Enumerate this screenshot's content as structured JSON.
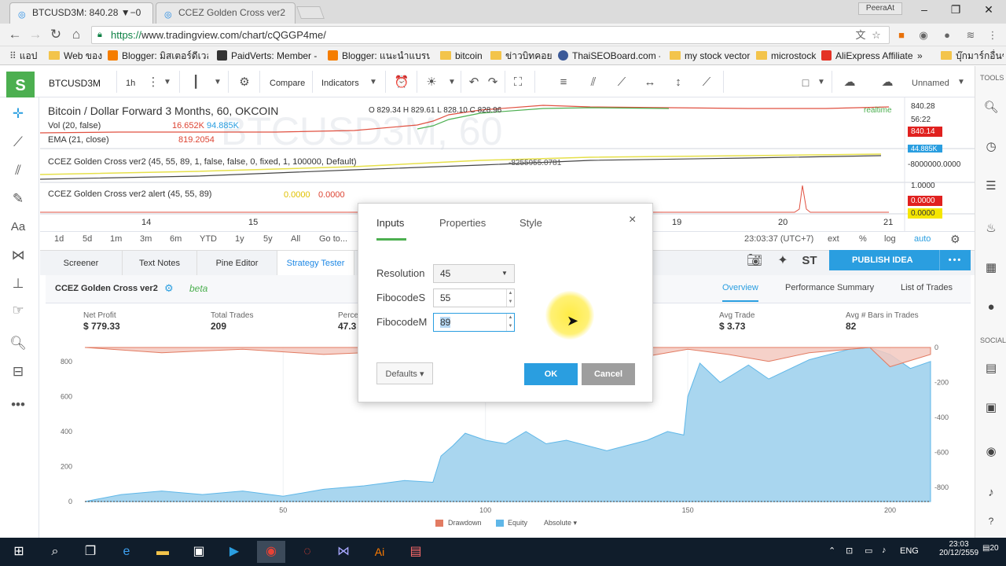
{
  "browser": {
    "tabs": [
      {
        "label": "BTCUSD3M: 840.28 ▼−0",
        "active": true
      },
      {
        "label": "CCEZ Golden Cross ver2",
        "active": false
      }
    ],
    "user": "PeeraAt",
    "url_prefix": "https://",
    "url_rest": "www.tradingview.com/chart/cQGGP4me/",
    "bookmarks": [
      "แอป",
      "Web ของ",
      "Blogger: มิสเตอร์ดีเวลลอปเปอร์",
      "PaidVerts: Member - F",
      "Blogger: แนะนำแบรนด์ดีๆ",
      "bitcoin",
      "ข่าวบิทคอยน์",
      "ThaiSEOBoard.com -",
      "my stock vector",
      "microstock",
      "AliExpress Affiliate",
      "»",
      "บุ๊กมาร์กอื่นๆ"
    ]
  },
  "toolbar": {
    "symbol": "BTCUSD3M",
    "interval": "1h",
    "compare": "Compare",
    "indicators": "Indicators",
    "layout_name": "Unnamed"
  },
  "chart": {
    "main_title": "Bitcoin / Dollar Forward 3 Months, 60, OKCOIN",
    "ohlc": "O 829.34 H 829.61 L 828.10 C 828.96",
    "vol_label": "Vol (20, false)",
    "vol_v1": "16.652K",
    "vol_v2": "94.885K",
    "ema_label": "EMA (21, close)",
    "ema_value": "819.2054",
    "ind1_label": "CCEZ Golden Cross ver2 (45, 55, 89, 1, false, false, 0, fixed, 1, 100000, Default)",
    "ind1_value": "-8255955.0781",
    "ind2_label": "CCEZ Golden Cross ver2 alert (45, 55, 89)",
    "ind2_v1": "0.0000",
    "ind2_v2": "0.0000",
    "realtime": "realtime",
    "watermark": "BTCUSD3M, 60",
    "prices": {
      "p1": "840.28",
      "p2": "56:22",
      "p3": "840.14",
      "p4": "44.885K",
      "p5": "-8000000.0000",
      "p6": "1.0000",
      "p7": "0.0000",
      "p8": "0.0000"
    },
    "time_ticks": [
      "14",
      "15",
      "19",
      "20",
      "21"
    ],
    "ranges": [
      "1d",
      "5d",
      "1m",
      "3m",
      "6m",
      "YTD",
      "1y",
      "5y",
      "All",
      "Go to..."
    ],
    "clock": "23:03:37 (UTC+7)",
    "right_opts": [
      "ext",
      "%",
      "log",
      "auto"
    ]
  },
  "bottom_panel": {
    "tabs": [
      "Screener",
      "Text Notes",
      "Pine Editor",
      "Strategy Tester"
    ],
    "publish": "PUBLISH IDEA",
    "strategy_name": "CCEZ Golden Cross ver2",
    "beta": "beta",
    "views": [
      "Overview",
      "Performance Summary",
      "List of Trades"
    ],
    "stats": [
      {
        "label": "Net Profit",
        "value": "$ 779.33"
      },
      {
        "label": "Total Trades",
        "value": "209"
      },
      {
        "label": "Percen",
        "value": "47.3"
      },
      {
        "label": "Avg Trade",
        "value": "$ 3.73"
      },
      {
        "label": "Avg # Bars in Trades",
        "value": "82"
      }
    ],
    "legend": {
      "drawdown": "Drawdown",
      "equity": "Equity",
      "absolute": "Absolute"
    }
  },
  "chart_data": {
    "type": "area",
    "x_ticks": [
      50,
      100,
      150,
      200
    ],
    "y_left_ticks": [
      0,
      200,
      400,
      600,
      800
    ],
    "y_right_ticks": [
      0,
      -200,
      -400,
      -600,
      -800
    ],
    "series": [
      {
        "name": "Equity",
        "color": "#a9d6ef",
        "points": [
          [
            1,
            0
          ],
          [
            10,
            40
          ],
          [
            20,
            60
          ],
          [
            30,
            40
          ],
          [
            40,
            60
          ],
          [
            50,
            30
          ],
          [
            60,
            70
          ],
          [
            70,
            90
          ],
          [
            80,
            120
          ],
          [
            87,
            110
          ],
          [
            89,
            260
          ],
          [
            92,
            320
          ],
          [
            95,
            390
          ],
          [
            100,
            350
          ],
          [
            105,
            330
          ],
          [
            110,
            400
          ],
          [
            115,
            330
          ],
          [
            120,
            350
          ],
          [
            130,
            290
          ],
          [
            140,
            350
          ],
          [
            145,
            400
          ],
          [
            149,
            380
          ],
          [
            150,
            600
          ],
          [
            153,
            790
          ],
          [
            158,
            680
          ],
          [
            165,
            780
          ],
          [
            170,
            700
          ],
          [
            180,
            810
          ],
          [
            190,
            870
          ],
          [
            195,
            880
          ],
          [
            200,
            840
          ],
          [
            205,
            760
          ],
          [
            210,
            800
          ]
        ]
      },
      {
        "name": "Drawdown",
        "color": "#f3c9c0",
        "points": [
          [
            1,
            0
          ],
          [
            20,
            -30
          ],
          [
            40,
            -10
          ],
          [
            60,
            -40
          ],
          [
            80,
            -20
          ],
          [
            100,
            -30
          ],
          [
            120,
            -20
          ],
          [
            140,
            -50
          ],
          [
            150,
            -10
          ],
          [
            160,
            -40
          ],
          [
            170,
            -80
          ],
          [
            180,
            -30
          ],
          [
            195,
            0
          ],
          [
            200,
            -110
          ],
          [
            210,
            -40
          ]
        ]
      }
    ]
  },
  "dialog": {
    "tabs": [
      "Inputs",
      "Properties",
      "Style"
    ],
    "fields": [
      {
        "label": "Resolution",
        "value": "45"
      },
      {
        "label": "FibocodeS",
        "value": "55"
      },
      {
        "label": "FibocodeM",
        "value": "89"
      }
    ],
    "defaults": "Defaults",
    "ok": "OK",
    "cancel": "Cancel"
  },
  "taskbar": {
    "lang": "ENG",
    "time": "23:03",
    "date": "20/12/2559",
    "notif": "20"
  }
}
